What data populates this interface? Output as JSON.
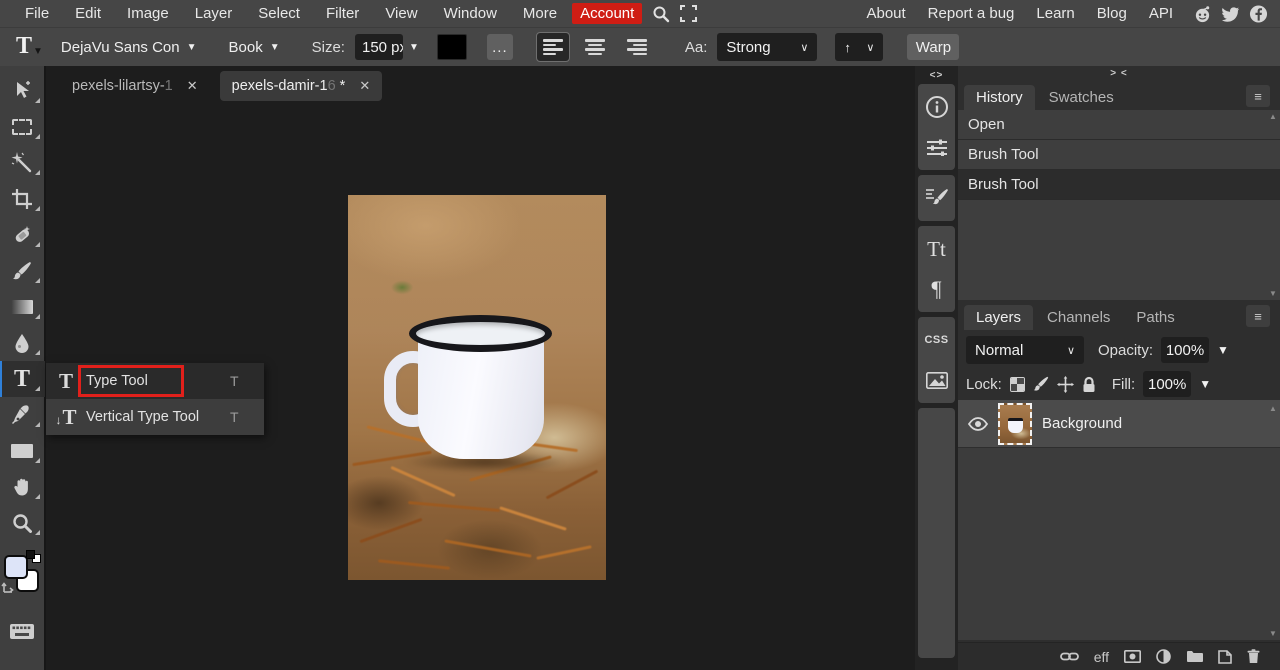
{
  "menubar": {
    "items": [
      "File",
      "Edit",
      "Image",
      "Layer",
      "Select",
      "Filter",
      "View",
      "Window",
      "More"
    ],
    "account_label": "Account",
    "right_items": [
      "About",
      "Report a bug",
      "Learn",
      "Blog",
      "API"
    ]
  },
  "optionsbar": {
    "font_name": "DejaVu Sans Con",
    "font_style": "Book",
    "size_label": "Size:",
    "size_value": "150 px",
    "aa_label": "Aa:",
    "aa_value": "Strong",
    "orientation_glyph": "↑",
    "more_glyph": "...",
    "warp_label": "Warp"
  },
  "doc_tabs": {
    "tab1": {
      "label": "pexels-lilartsy-",
      "faded_char": "1",
      "modified": ""
    },
    "tab2": {
      "label": "pexels-damir-1",
      "faded_char": "6",
      "modified": " *"
    }
  },
  "tool_popup": {
    "item1": {
      "label": "Type Tool",
      "shortcut": "T",
      "icon_glyph": "T"
    },
    "item2": {
      "label": "Vertical Type Tool",
      "shortcut": "T",
      "icon_glyph": "T",
      "icon_arrow": "↓"
    }
  },
  "glyphs": {
    "collapse_left": "<>",
    "collapse_right": "> <",
    "hamburger": "≡",
    "chevron_down": "∨",
    "triangle_down": "▼",
    "type_tool": "T",
    "character_panel": "Tt",
    "paragraph_panel": "¶",
    "css_panel": "CSS",
    "effects": "eff",
    "scroll_up": "▲",
    "scroll_down": "▼"
  },
  "history_panel": {
    "tab_history": "History",
    "tab_swatches": "Swatches",
    "entry1": "Open",
    "entry2": "Brush Tool",
    "entry3": "Brush Tool"
  },
  "layers_panel": {
    "tab_layers": "Layers",
    "tab_channels": "Channels",
    "tab_paths": "Paths",
    "blend_mode": "Normal",
    "opacity_label": "Opacity:",
    "opacity_value": "100%",
    "lock_label": "Lock:",
    "fill_label": "Fill:",
    "fill_value": "100%",
    "layer1_name": "Background"
  },
  "colors": {
    "accent_red": "#cf1d14",
    "annotation_red": "#e1201b",
    "selection_blue": "#2f80d9",
    "bar_bg": "#464646",
    "panel_bg": "#2e2e2e",
    "canvas_bg": "#1d1d1d"
  }
}
